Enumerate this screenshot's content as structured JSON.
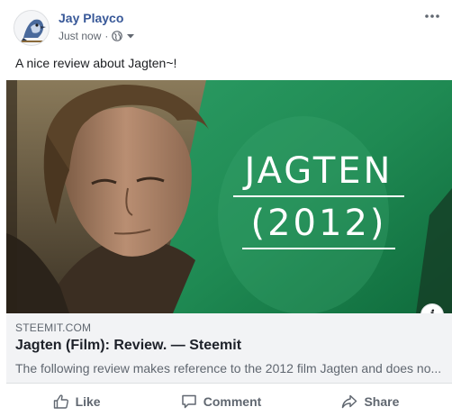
{
  "post": {
    "author": "Jay Playco",
    "timestamp": "Just now",
    "separator": "·",
    "privacy_icon": "globe-icon",
    "message": "A nice review about Jagten~!"
  },
  "preview": {
    "image_title_line1": "JAGTEN",
    "image_title_line2": "(2012)",
    "domain": "STEEMIT.COM",
    "title": "Jagten (Film): Review. — Steemit",
    "description": "The following review makes reference to the 2012 film Jagten and does no...",
    "info_label": "i"
  },
  "actions": {
    "like": "Like",
    "comment": "Comment",
    "share": "Share"
  },
  "colors": {
    "author": "#385898",
    "green": "#1f8a53",
    "link_bg": "#f2f3f5"
  }
}
